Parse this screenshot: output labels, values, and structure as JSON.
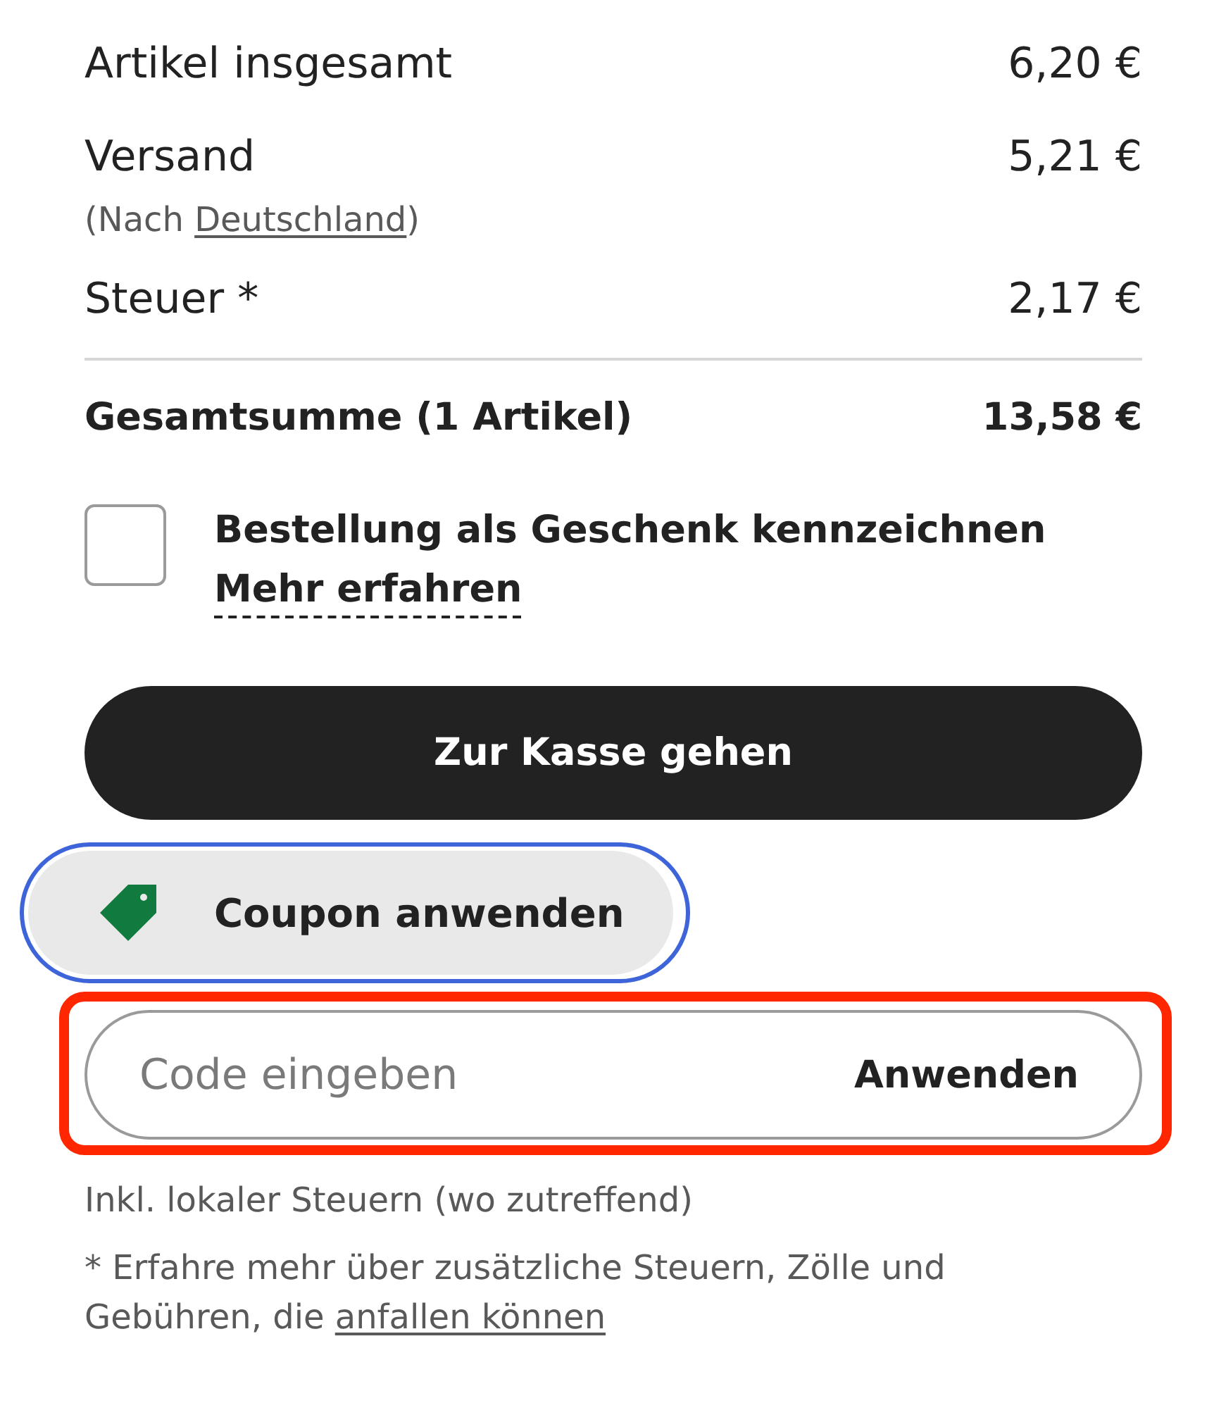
{
  "summary": {
    "rows": [
      {
        "label": "Artikel insgesamt",
        "value": "6,20 €"
      },
      {
        "label": "Versand",
        "value": "5,21 €",
        "note": {
          "prefix": "(Nach ",
          "link": "Deutschland",
          "suffix": ")"
        }
      },
      {
        "label": "Steuer *",
        "value": "2,17 €"
      }
    ],
    "total": {
      "label": "Gesamtsumme (1 Artikel)",
      "value": "13,58 €"
    }
  },
  "gift": {
    "checked": false,
    "label": "Bestellung als Geschenk kennzeichnen",
    "link": "Mehr erfahren"
  },
  "checkout_button": {
    "label": "Zur Kasse gehen"
  },
  "coupon_button": {
    "label": "Coupon anwenden",
    "focused": true
  },
  "coupon_field": {
    "placeholder": "Code eingeben",
    "apply": "Anwenden",
    "highlighted": true
  },
  "notes": [
    {
      "text": "Inkl. lokaler Steuern (wo zutreffend)"
    },
    {
      "text": "* Erfahre mehr über zusätzliche Steuern, Zölle und Gebühren, die ",
      "link": "anfallen können"
    }
  ]
}
